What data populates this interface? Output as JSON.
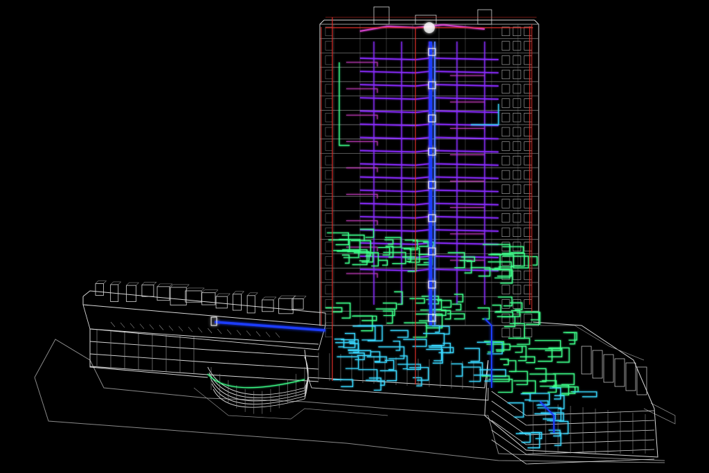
{
  "scene": {
    "background": "#000000",
    "colors": {
      "structure": "#d8d8d8",
      "structure_dim": "#8a8a8a",
      "frame": "#e0302a",
      "riser": "#1e3cff",
      "riser_glow": "#4f7bff",
      "plumbing": "#8a2cff",
      "plumbing_pink": "#d040c8",
      "hvac": "#3cff8a",
      "cyan": "#38d8ff",
      "highlight": "#ffffff"
    },
    "tower_floors": 21,
    "tower_bays": 4,
    "icons": [
      "building-wireframe-icon"
    ]
  }
}
